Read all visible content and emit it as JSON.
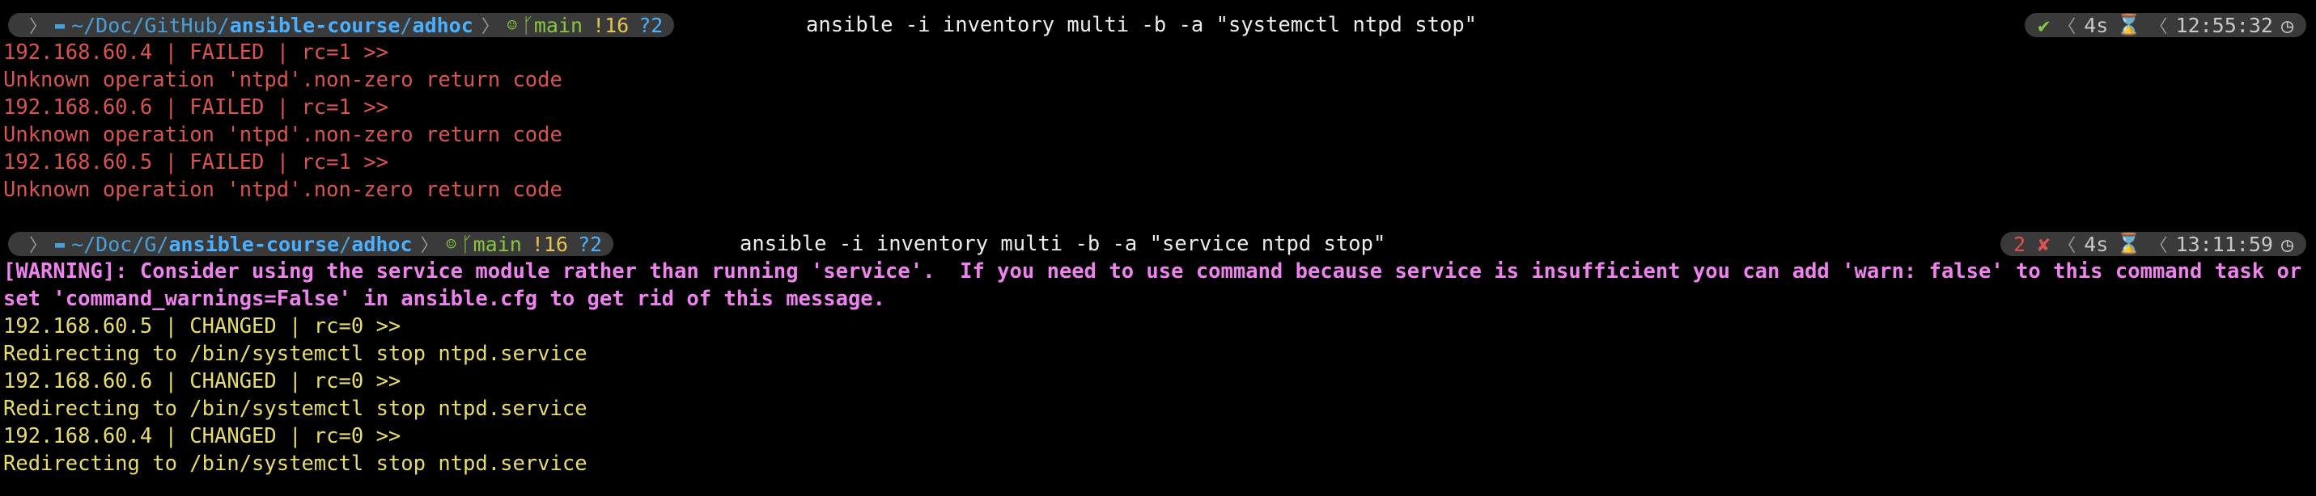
{
  "theme": {
    "background": "#000000",
    "segment_bg": "#3a3a3a",
    "error_text": "#d9534f",
    "changed_text": "#e8dd6b",
    "warning_text": "#ee82ee",
    "path_color": "#4ab0ff",
    "git_color": "#88c540"
  },
  "prompt1": {
    "os_icon": "apple-icon",
    "folder_icon": "folder-icon",
    "path_dim": "~/Doc/GitHub/",
    "path_bold_1": "ansible-course",
    "path_slash": "/",
    "path_bold_2": "adhoc",
    "git_icon": "github-cat-icon",
    "branch_icon": "git-branch-icon",
    "branch": "main",
    "modified": "!16",
    "untracked": "?2",
    "command": "ansible -i inventory multi -b -a \"systemctl ntpd stop\"",
    "status": "✔",
    "duration": "4s",
    "hourglass": "⌛",
    "time": "12:55:32",
    "clock": "◷"
  },
  "output1": [
    "192.168.60.4 | FAILED | rc=1 >>",
    "Unknown operation 'ntpd'.non-zero return code",
    "192.168.60.6 | FAILED | rc=1 >>",
    "Unknown operation 'ntpd'.non-zero return code",
    "192.168.60.5 | FAILED | rc=1 >>",
    "Unknown operation 'ntpd'.non-zero return code"
  ],
  "prompt2": {
    "os_icon": "apple-icon",
    "folder_icon": "folder-icon",
    "path_dim": "~/Doc/G/",
    "path_bold_1": "ansible-course",
    "path_slash": "/",
    "path_bold_2": "adhoc",
    "git_icon": "github-cat-icon",
    "branch_icon": "git-branch-icon",
    "branch": "main",
    "modified": "!16",
    "untracked": "?2",
    "command": "ansible -i inventory multi -b -a \"service ntpd stop\"",
    "status": "2 ✘",
    "duration": "4s",
    "hourglass": "⌛",
    "time": "13:11:59",
    "clock": "◷"
  },
  "warning": "[WARNING]: Consider using the service module rather than running 'service'.  If you need to use command because service is insufficient you can add 'warn: false' to this command task or set 'command_warnings=False' in ansible.cfg to get rid of this message.",
  "output2": [
    "192.168.60.5 | CHANGED | rc=0 >>",
    "Redirecting to /bin/systemctl stop ntpd.service",
    "192.168.60.6 | CHANGED | rc=0 >>",
    "Redirecting to /bin/systemctl stop ntpd.service",
    "192.168.60.4 | CHANGED | rc=0 >>",
    "Redirecting to /bin/systemctl stop ntpd.service"
  ]
}
